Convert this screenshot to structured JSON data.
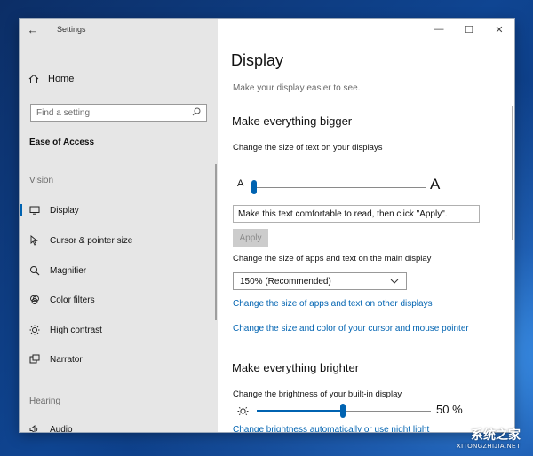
{
  "window": {
    "title": "Settings",
    "back_icon": "←",
    "minimize_icon": "—",
    "maximize_icon": "☐",
    "close_icon": "✕"
  },
  "sidebar": {
    "home_label": "Home",
    "search_placeholder": "Find a setting",
    "section_label": "Ease of Access",
    "vision_label": "Vision",
    "items": [
      {
        "label": "Display",
        "icon": "monitor-icon",
        "active": true
      },
      {
        "label": "Cursor & pointer size",
        "icon": "cursor-icon",
        "active": false
      },
      {
        "label": "Magnifier",
        "icon": "magnifier-icon",
        "active": false
      },
      {
        "label": "Color filters",
        "icon": "color-filter-icon",
        "active": false
      },
      {
        "label": "High contrast",
        "icon": "high-contrast-icon",
        "active": false
      },
      {
        "label": "Narrator",
        "icon": "narrator-icon",
        "active": false
      }
    ],
    "hearing_label": "Hearing",
    "hearing_items": [
      {
        "label": "Audio",
        "icon": "speaker-icon"
      }
    ]
  },
  "main": {
    "title": "Display",
    "subtitle": "Make your display easier to see.",
    "bigger": {
      "heading": "Make everything bigger",
      "text_size_label": "Change the size of text on your displays",
      "small_a": "A",
      "big_a": "A",
      "text_size_value": 0,
      "sample_text": "Make this text comfortable to read, then click \"Apply\".",
      "apply_label": "Apply",
      "scale_label": "Change the size of apps and text on the main display",
      "scale_value": "150% (Recommended)",
      "link_other_displays": "Change the size of apps and text on other displays",
      "link_cursor": "Change the size and color of your cursor and mouse pointer"
    },
    "brighter": {
      "heading": "Make everything brighter",
      "brightness_label": "Change the brightness of your built-in display",
      "brightness_value": "50 %",
      "link_auto": "Change brightness automatically or use night light"
    }
  },
  "watermark": {
    "line1": "系统之家",
    "line2": "XITONGZHIJIA.NET"
  },
  "colors": {
    "accent": "#0063b1",
    "sidebar_bg": "#e6e6e6",
    "link": "#0063b1"
  }
}
